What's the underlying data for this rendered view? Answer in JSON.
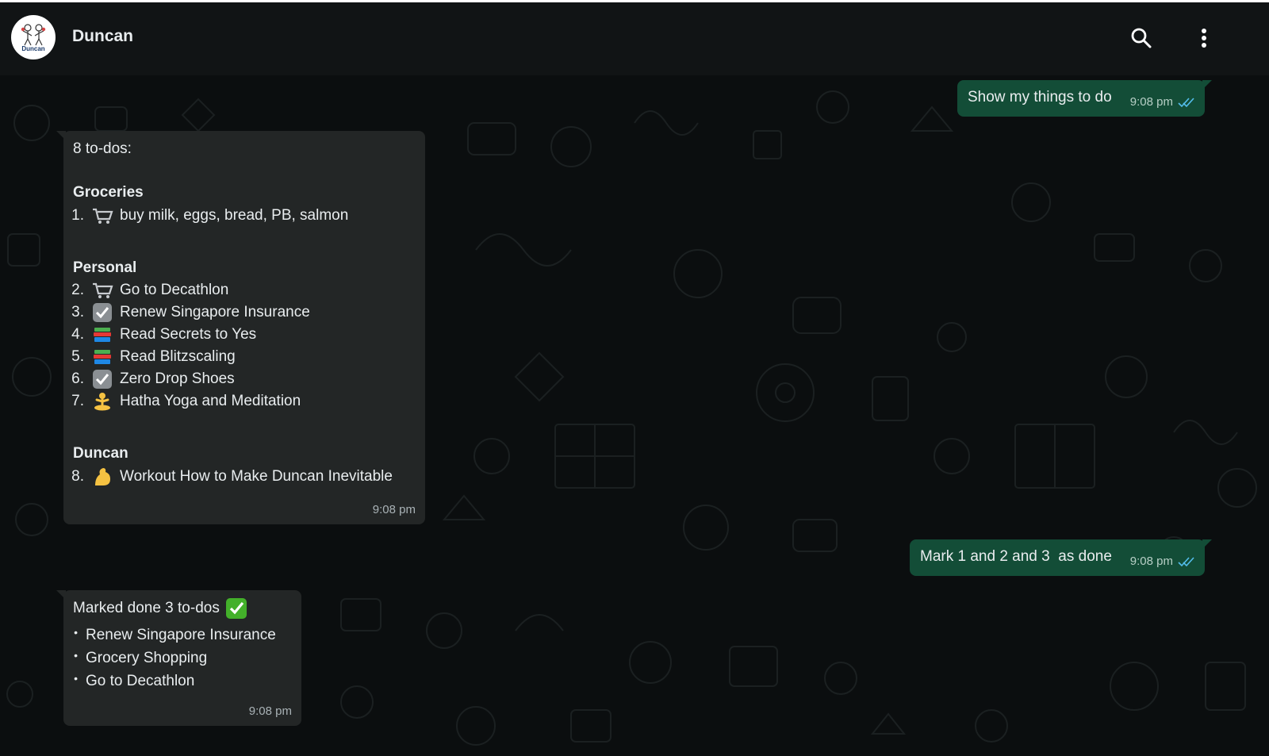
{
  "header": {
    "contact_name": "Duncan",
    "avatar_text": "Duncan",
    "search_icon": "search-icon",
    "menu_icon": "more-vertical-icon"
  },
  "colors": {
    "header_bg": "#111415",
    "chat_bg": "#0b0e0f",
    "incoming_bubble": "#232626",
    "outgoing_bubble": "#134d37",
    "read_ticks": "#53bdeb"
  },
  "messages": {
    "m1": {
      "direction": "outgoing",
      "text": "Show my things to do",
      "time": "9:08 pm",
      "status_icon": "double-check-icon"
    },
    "m2": {
      "direction": "incoming",
      "intro": "8 to-dos:",
      "sections": [
        {
          "title": "Groceries",
          "items": [
            {
              "num": "1.",
              "emoji": "cart",
              "text": "buy milk, eggs, bread, PB, salmon"
            }
          ]
        },
        {
          "title": "Personal",
          "items": [
            {
              "num": "2.",
              "emoji": "cart",
              "text": "Go to Decathlon"
            },
            {
              "num": "3.",
              "emoji": "check",
              "text": "Renew Singapore Insurance"
            },
            {
              "num": "4.",
              "emoji": "books",
              "text": "Read Secrets to Yes"
            },
            {
              "num": "5.",
              "emoji": "books",
              "text": "Read Blitzscaling"
            },
            {
              "num": "6.",
              "emoji": "check",
              "text": "Zero Drop Shoes"
            },
            {
              "num": "7.",
              "emoji": "yoga",
              "text": "Hatha Yoga and Meditation"
            }
          ]
        },
        {
          "title": "Duncan",
          "items": [
            {
              "num": "8.",
              "emoji": "muscle",
              "text": "Workout How to Make Duncan Inevitable"
            }
          ]
        }
      ],
      "time": "9:08 pm"
    },
    "m3": {
      "direction": "outgoing",
      "text": "Mark 1 and 2 and 3  as done",
      "time": "9:08 pm",
      "status_icon": "double-check-icon"
    },
    "m4": {
      "direction": "incoming",
      "intro": "Marked done 3 to-dos",
      "intro_emoji": "check-box-green",
      "bullets": [
        "Renew Singapore Insurance",
        "Grocery Shopping",
        "Go to Decathlon"
      ],
      "time": "9:08 pm"
    }
  }
}
